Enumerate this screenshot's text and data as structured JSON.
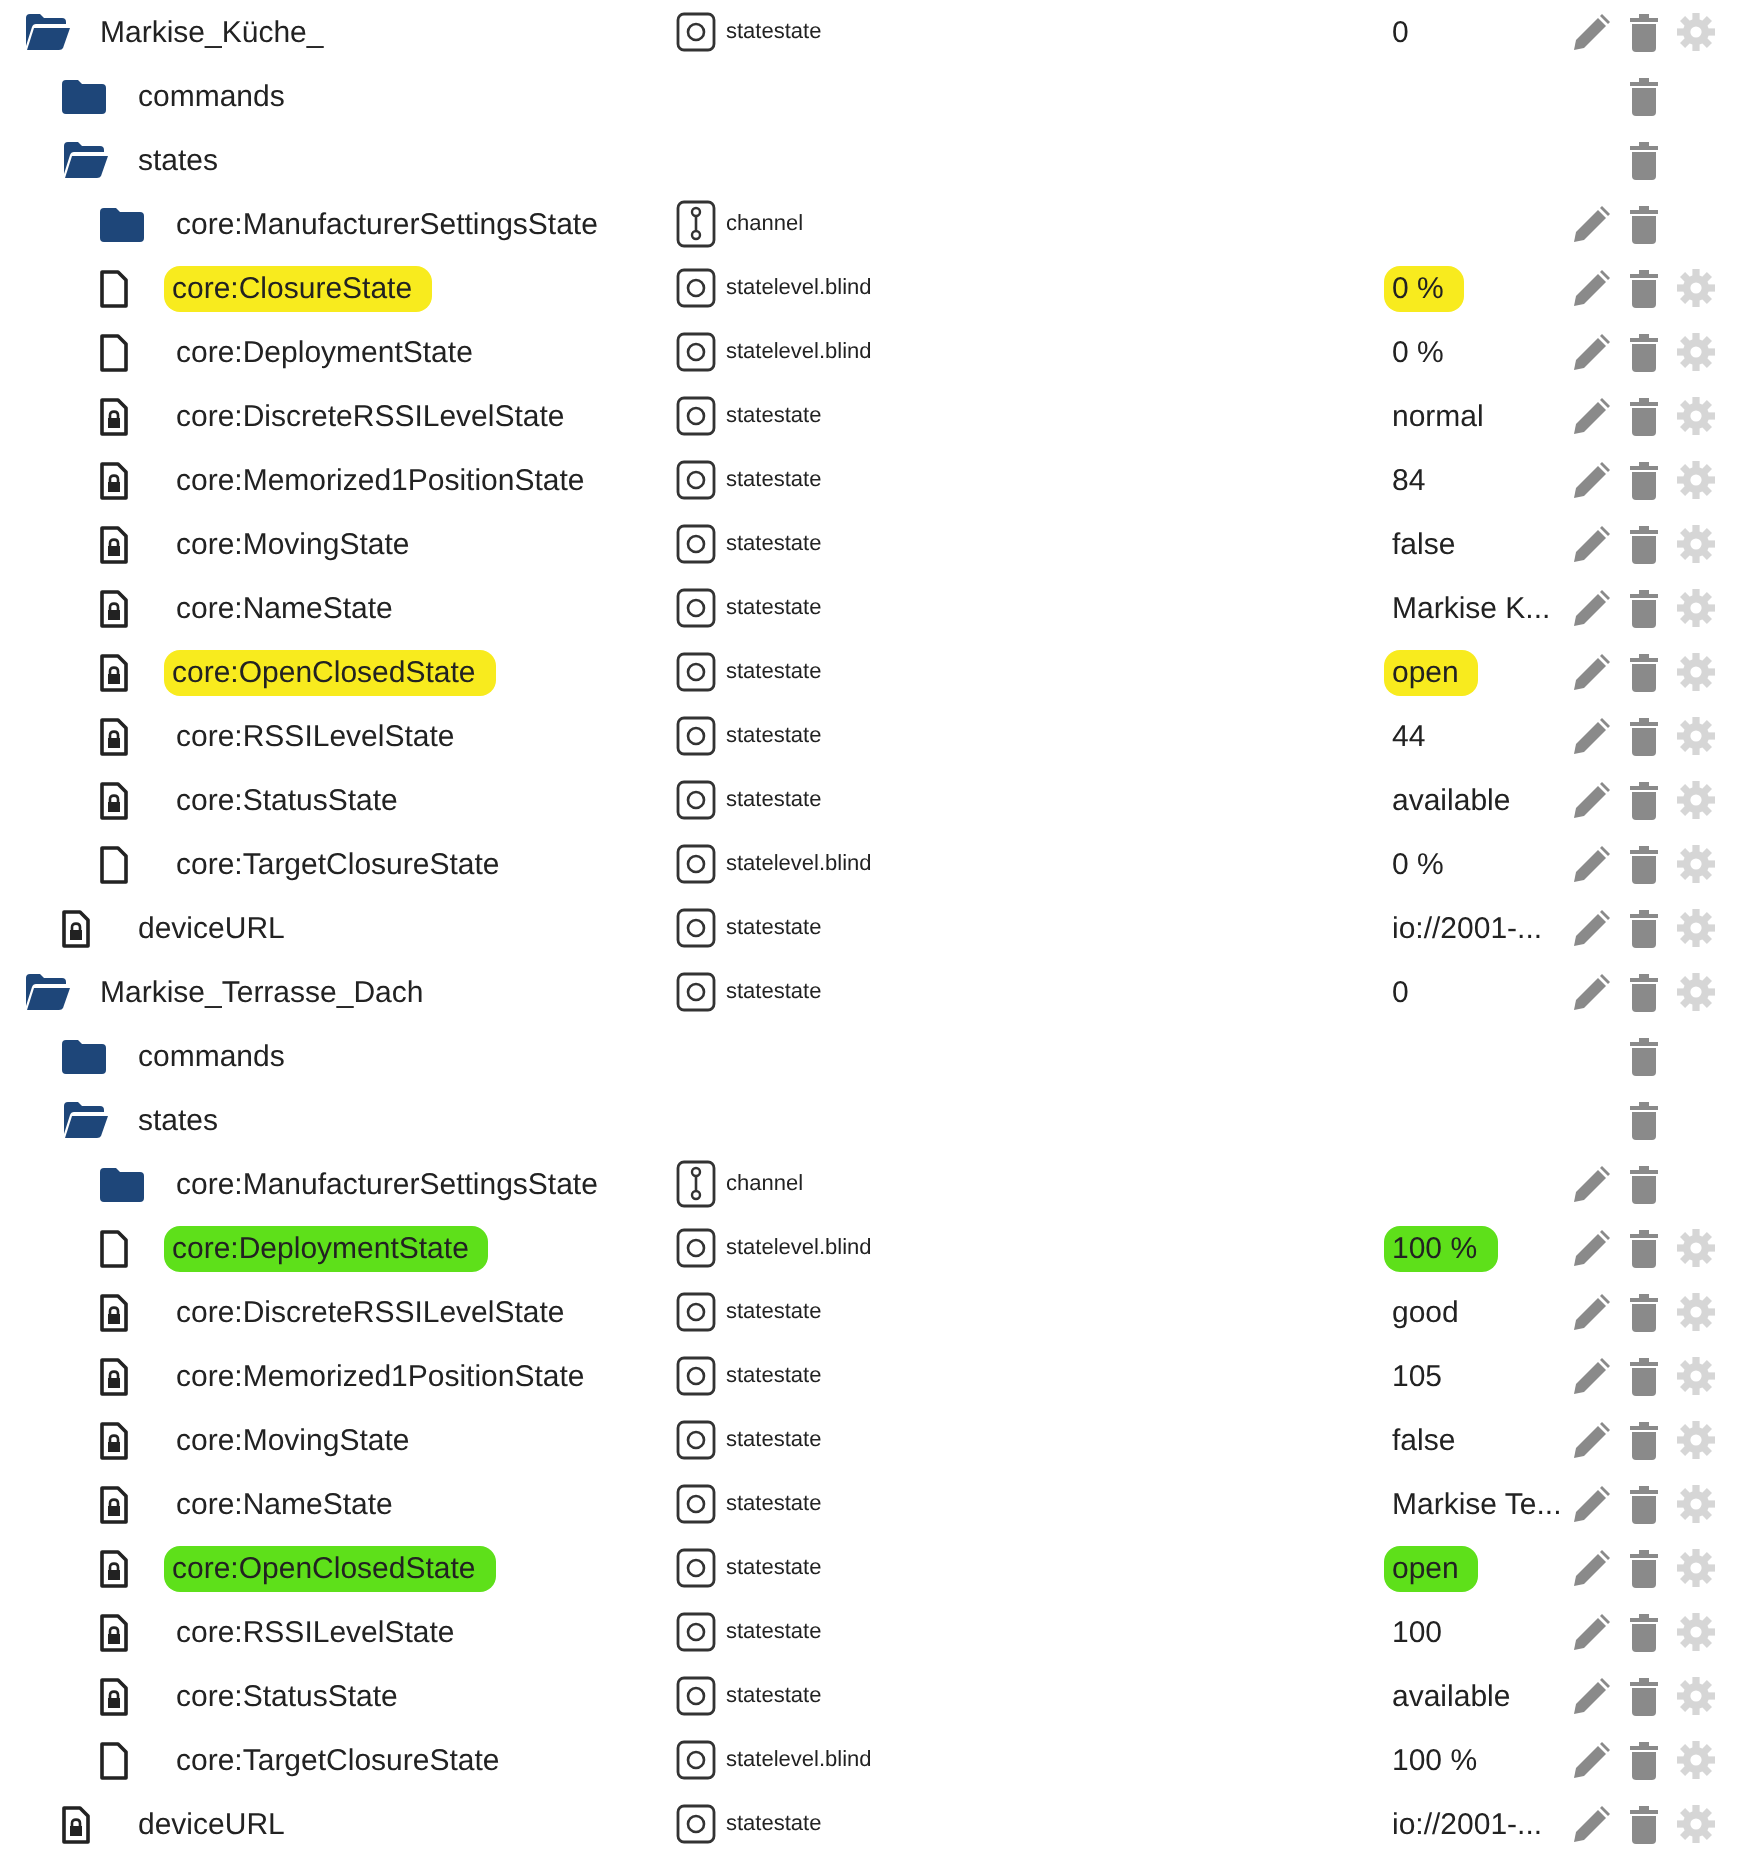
{
  "devices": [
    {
      "name": "Markise_Küche_",
      "kind": "folder",
      "expanded": true,
      "channel": false,
      "type": "statestate",
      "value": "0",
      "edit": true,
      "settings": true,
      "children": [
        {
          "name": "commands",
          "kind": "folder",
          "expanded": false,
          "edit": false,
          "settings": false
        },
        {
          "name": "states",
          "kind": "folder",
          "expanded": true,
          "edit": false,
          "settings": false,
          "children": [
            {
              "name": "core:ManufacturerSettingsState",
              "kind": "folder",
              "expanded": false,
              "channel": true,
              "type": "channel",
              "edit": true,
              "settings": false
            },
            {
              "name": "core:ClosureState",
              "kind": "state",
              "locked": false,
              "channel": false,
              "type": "statelevel.blind",
              "value": "0 %",
              "edit": true,
              "settings": true,
              "color": "#f8eb1e"
            },
            {
              "name": "core:DeploymentState",
              "kind": "state",
              "locked": false,
              "channel": false,
              "type": "statelevel.blind",
              "value": "0 %",
              "edit": true,
              "settings": true
            },
            {
              "name": "core:DiscreteRSSILevelState",
              "kind": "state",
              "locked": true,
              "channel": false,
              "type": "statestate",
              "value": "normal",
              "edit": true,
              "settings": true
            },
            {
              "name": "core:Memorized1PositionState",
              "kind": "state",
              "locked": true,
              "channel": false,
              "type": "statestate",
              "value": "84",
              "edit": true,
              "settings": true
            },
            {
              "name": "core:MovingState",
              "kind": "state",
              "locked": true,
              "channel": false,
              "type": "statestate",
              "value": "false",
              "edit": true,
              "settings": true
            },
            {
              "name": "core:NameState",
              "kind": "state",
              "locked": true,
              "channel": false,
              "type": "statestate",
              "value": "Markise K...",
              "edit": true,
              "settings": true
            },
            {
              "name": "core:OpenClosedState",
              "kind": "state",
              "locked": true,
              "channel": false,
              "type": "statestate",
              "value": "open",
              "edit": true,
              "settings": true,
              "color": "#f8eb1e"
            },
            {
              "name": "core:RSSILevelState",
              "kind": "state",
              "locked": true,
              "channel": false,
              "type": "statestate",
              "value": "44",
              "edit": true,
              "settings": true
            },
            {
              "name": "core:StatusState",
              "kind": "state",
              "locked": true,
              "channel": false,
              "type": "statestate",
              "value": "available",
              "edit": true,
              "settings": true
            },
            {
              "name": "core:TargetClosureState",
              "kind": "state",
              "locked": false,
              "channel": false,
              "type": "statelevel.blind",
              "value": "0 %",
              "edit": true,
              "settings": true
            }
          ]
        },
        {
          "name": "deviceURL",
          "kind": "state",
          "locked": true,
          "channel": false,
          "type": "statestate",
          "value": "io://2001-...",
          "edit": true,
          "settings": true
        }
      ]
    },
    {
      "name": "Markise_Terrasse_Dach",
      "kind": "folder",
      "expanded": true,
      "channel": false,
      "type": "statestate",
      "value": "0",
      "edit": true,
      "settings": true,
      "children": [
        {
          "name": "commands",
          "kind": "folder",
          "expanded": false,
          "edit": false,
          "settings": false
        },
        {
          "name": "states",
          "kind": "folder",
          "expanded": true,
          "edit": false,
          "settings": false,
          "children": [
            {
              "name": "core:ManufacturerSettingsState",
              "kind": "folder",
              "expanded": false,
              "channel": true,
              "type": "channel",
              "edit": true,
              "settings": false
            },
            {
              "name": "core:DeploymentState",
              "kind": "state",
              "locked": false,
              "channel": false,
              "type": "statelevel.blind",
              "value": "100 %",
              "edit": true,
              "settings": true,
              "color": "#5ee01a"
            },
            {
              "name": "core:DiscreteRSSILevelState",
              "kind": "state",
              "locked": true,
              "channel": false,
              "type": "statestate",
              "value": "good",
              "edit": true,
              "settings": true
            },
            {
              "name": "core:Memorized1PositionState",
              "kind": "state",
              "locked": true,
              "channel": false,
              "type": "statestate",
              "value": "105",
              "edit": true,
              "settings": true
            },
            {
              "name": "core:MovingState",
              "kind": "state",
              "locked": true,
              "channel": false,
              "type": "statestate",
              "value": "false",
              "edit": true,
              "settings": true
            },
            {
              "name": "core:NameState",
              "kind": "state",
              "locked": true,
              "channel": false,
              "type": "statestate",
              "value": "Markise Te...",
              "edit": true,
              "settings": true
            },
            {
              "name": "core:OpenClosedState",
              "kind": "state",
              "locked": true,
              "channel": false,
              "type": "statestate",
              "value": "open",
              "edit": true,
              "settings": true,
              "color": "#5ee01a"
            },
            {
              "name": "core:RSSILevelState",
              "kind": "state",
              "locked": true,
              "channel": false,
              "type": "statestate",
              "value": "100",
              "edit": true,
              "settings": true
            },
            {
              "name": "core:StatusState",
              "kind": "state",
              "locked": true,
              "channel": false,
              "type": "statestate",
              "value": "available",
              "edit": true,
              "settings": true
            },
            {
              "name": "core:TargetClosureState",
              "kind": "state",
              "locked": false,
              "channel": false,
              "type": "statelevel.blind",
              "value": "100 %",
              "edit": true,
              "settings": true
            }
          ]
        },
        {
          "name": "deviceURL",
          "kind": "state",
          "locked": true,
          "channel": false,
          "type": "statestate",
          "value": "io://2001-...",
          "edit": true,
          "settings": true
        }
      ]
    }
  ]
}
